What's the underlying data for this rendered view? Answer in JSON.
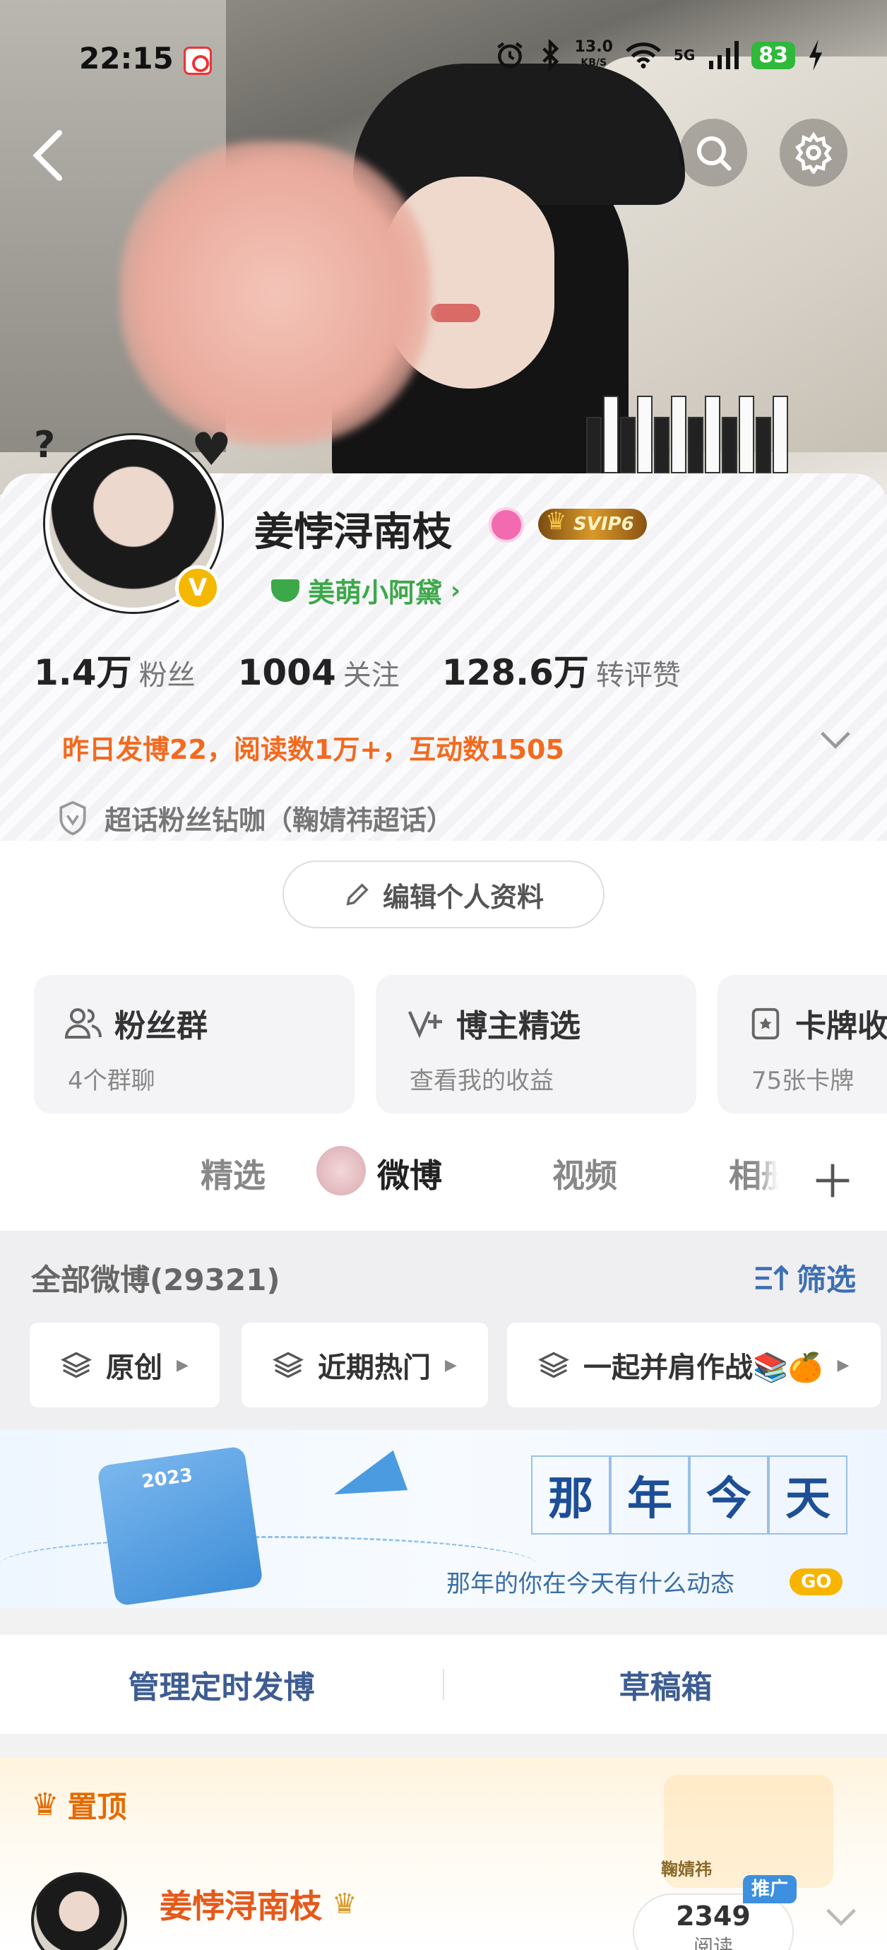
{
  "status_bar": {
    "time": "22:15",
    "net_speed": "13.0",
    "net_unit": "KB/S",
    "network": "5G",
    "battery": "83"
  },
  "profile": {
    "name": "姜悖浔南枝",
    "vip_badge": "SVIP6",
    "group_link": "美萌小阿黛",
    "stats": [
      {
        "value": "1.4万",
        "label": "粉丝"
      },
      {
        "value": "1004",
        "label": "关注"
      },
      {
        "value": "128.6万",
        "label": "转评赞"
      }
    ],
    "activity": "昨日发博22，阅读数1万+，互动数1505",
    "supertopic": "超话粉丝钻咖（鞠婧祎超话）",
    "edit_label": "编辑个人资料"
  },
  "features": [
    {
      "title": "粉丝群",
      "subtitle": "4个群聊",
      "icon": "people-icon"
    },
    {
      "title": "博主精选",
      "subtitle": "查看我的收益",
      "icon": "v-plus-icon"
    },
    {
      "title": "卡牌收",
      "subtitle": "75张卡牌",
      "icon": "card-icon"
    }
  ],
  "tabs": [
    "精选",
    "微博",
    "视频",
    "相册"
  ],
  "active_tab": "微博",
  "feed": {
    "all_count": "全部微博(29321)",
    "filter_label": "筛选",
    "chips": [
      "原创",
      "近期热门",
      "一起并肩作战📚🍊"
    ]
  },
  "banner": {
    "year_chars": [
      "那",
      "年",
      "今",
      "天"
    ],
    "subtitle": "那年的你在今天有什么动态",
    "go_label": "GO"
  },
  "actions": {
    "scheduled": "管理定时发博",
    "drafts": "草稿箱"
  },
  "pinned": {
    "label": "置顶",
    "author": "姜悖浔南枝",
    "tag_text": "鞠婧祎",
    "promo_label": "推广",
    "reads_count": "2349",
    "reads_label": "阅读"
  },
  "colors": {
    "accent_orange": "#f26a1f",
    "link_blue": "#3d6fb2",
    "green": "#3da84a",
    "battery_green": "#2fb93a"
  }
}
